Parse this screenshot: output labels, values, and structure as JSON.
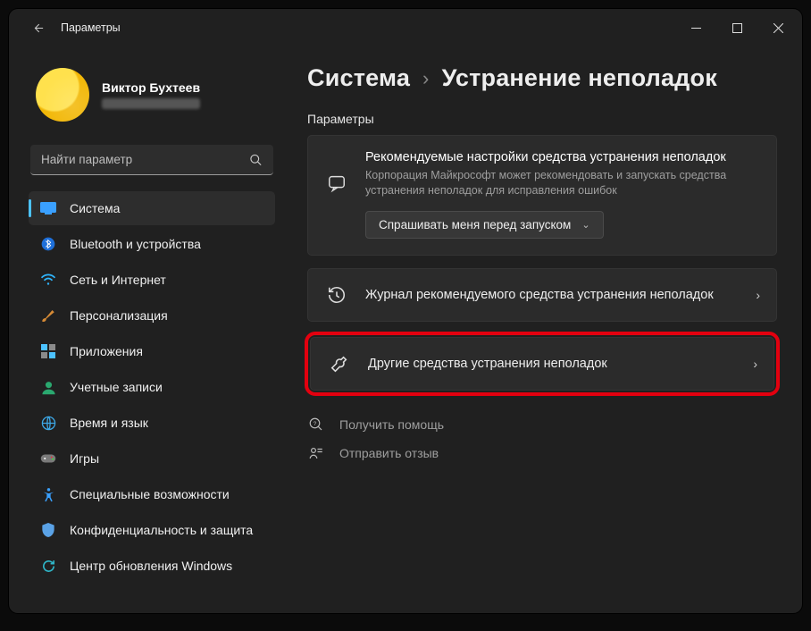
{
  "titlebar": {
    "title": "Параметры"
  },
  "profile": {
    "name": "Виктор Бухтеев"
  },
  "search": {
    "placeholder": "Найти параметр"
  },
  "nav": {
    "items": [
      {
        "label": "Система"
      },
      {
        "label": "Bluetooth и устройства"
      },
      {
        "label": "Сеть и Интернет"
      },
      {
        "label": "Персонализация"
      },
      {
        "label": "Приложения"
      },
      {
        "label": "Учетные записи"
      },
      {
        "label": "Время и язык"
      },
      {
        "label": "Игры"
      },
      {
        "label": "Специальные возможности"
      },
      {
        "label": "Конфиденциальность и защита"
      },
      {
        "label": "Центр обновления Windows"
      }
    ]
  },
  "crumbs": {
    "root": "Система",
    "leaf": "Устранение неполадок"
  },
  "section": {
    "label": "Параметры"
  },
  "rec": {
    "title": "Рекомендуемые настройки средства устранения неполадок",
    "sub": "Корпорация Майкрософт может рекомендовать и запускать средства устранения неполадок для исправления ошибок",
    "dropdown": "Спрашивать меня перед запуском"
  },
  "rows": {
    "history": "Журнал рекомендуемого средства устранения неполадок",
    "other": "Другие средства устранения неполадок"
  },
  "links": {
    "help": "Получить помощь",
    "feedback": "Отправить отзыв"
  }
}
